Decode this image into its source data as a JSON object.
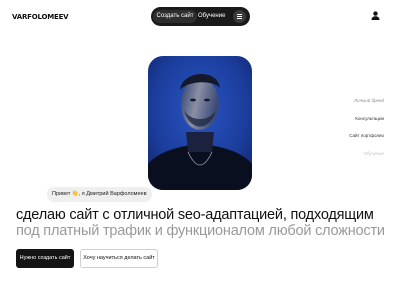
{
  "header": {
    "logo": "VARFOLOMEEV",
    "nav": {
      "create_label": "Создать сайт",
      "learn_label": "Обучение"
    }
  },
  "side_nav": {
    "items": [
      {
        "label": "Личный бренд"
      },
      {
        "label": "Консультации"
      },
      {
        "label": "Сайт портфолио"
      },
      {
        "label": "Обучение"
      }
    ]
  },
  "hero": {
    "greeting": "Привет 👋, я Дмитрий Варфоломеев",
    "headline_line1": "сделаю сайт с отличной seo-адаптацией, подходящим",
    "headline_line2": "под платный трафик и функционалом любой сложности",
    "primary_button": "Нужно создать сайт",
    "secondary_button": "Хочу научиться делать сайт"
  },
  "colors": {
    "nav_bg": "#1a1a1a",
    "portrait_bg": "#1e3f9e",
    "text_dark": "#111111",
    "text_muted": "#9a9a9a"
  },
  "icons": {
    "menu": "hamburger-icon",
    "user": "user-icon"
  }
}
